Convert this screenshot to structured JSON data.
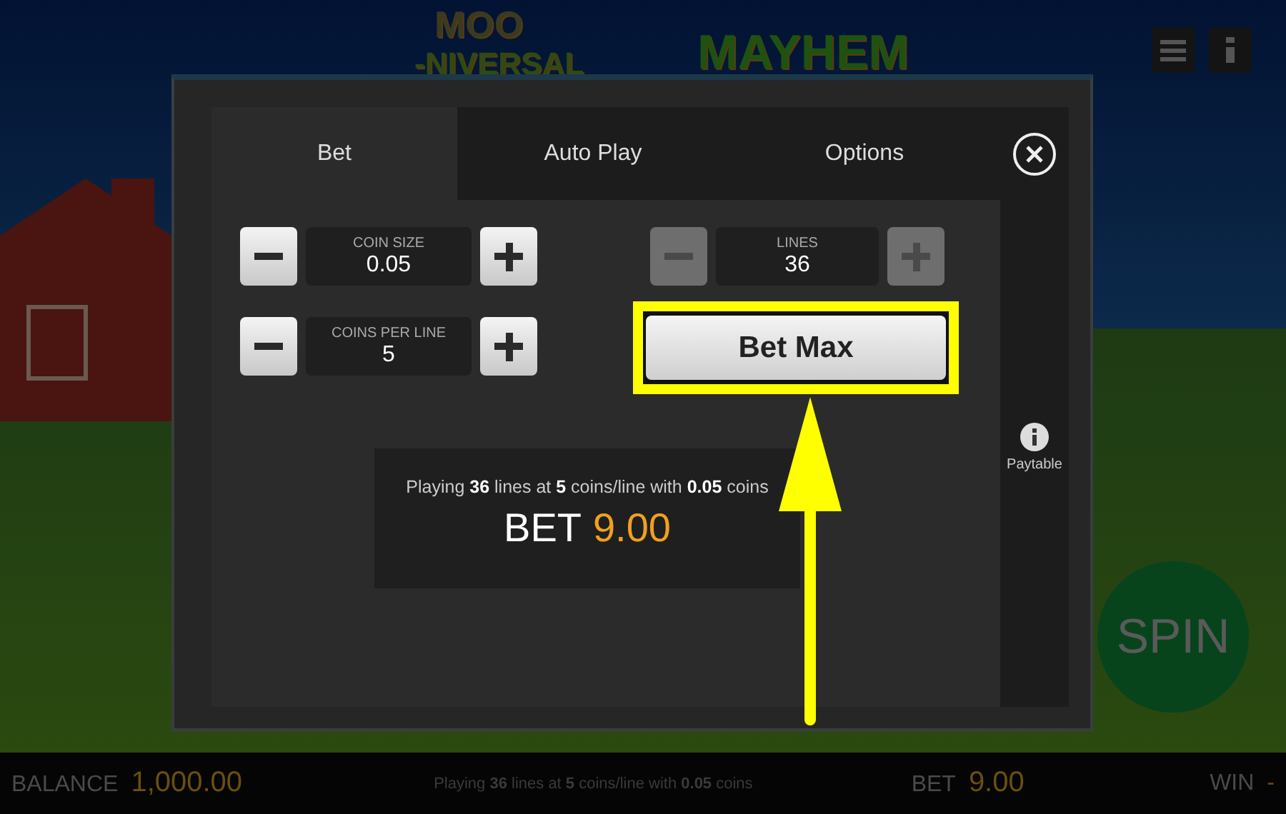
{
  "logo": {
    "line_1": "MOO",
    "line_2": "-NIVERSAL",
    "line_3": "MAYHEM"
  },
  "tabs": [
    {
      "label": "Bet",
      "selected": true
    },
    {
      "label": "Auto Play",
      "selected": false
    },
    {
      "label": "Options",
      "selected": false
    }
  ],
  "steppers": [
    {
      "label": "COIN SIZE",
      "value": "0.05",
      "disabled": false
    },
    {
      "label": "COINS PER LINE",
      "value": "5",
      "disabled": false
    },
    {
      "label": "LINES",
      "value": "36",
      "disabled": true
    }
  ],
  "bet_max_button": {
    "label": "Bet Max",
    "highlighted": true
  },
  "summary": {
    "text": "Playing **36** lines at **5** coins/line with **0.05** coins",
    "bet_label": "BET",
    "bet_value": "9.00"
  },
  "paytable": {
    "label": "Paytable"
  },
  "spin_button": {
    "label": "SPIN"
  },
  "status_bar": {
    "balance_label": "BALANCE",
    "balance": "1,000.00",
    "summary": "Playing **36** lines at **5** coins/line with **0.05** coins",
    "bet_label": "BET",
    "bet": "9.00",
    "win_label": "WIN",
    "win": "-"
  }
}
